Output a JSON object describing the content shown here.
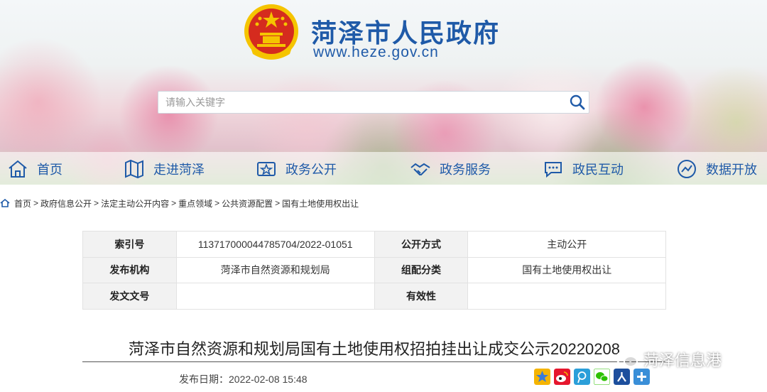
{
  "header": {
    "site_title": "菏泽市人民政府",
    "site_url": "www.heze.gov.cn",
    "search_placeholder": "请输入关键字",
    "emblem_icon": "national-emblem-icon"
  },
  "nav": [
    {
      "label": "首页",
      "icon": "home-icon"
    },
    {
      "label": "走进菏泽",
      "icon": "map-icon"
    },
    {
      "label": "政务公开",
      "icon": "gov-open-icon"
    },
    {
      "label": "政务服务",
      "icon": "handshake-icon"
    },
    {
      "label": "政民互动",
      "icon": "chat-icon"
    },
    {
      "label": "数据开放",
      "icon": "data-icon"
    }
  ],
  "breadcrumb": [
    "首页",
    "政府信息公开",
    "法定主动公开内容",
    "重点领域",
    "公共资源配置",
    "国有土地使用权出让"
  ],
  "meta": {
    "index_label": "索引号",
    "index_value": "113717000044785704/2022-01051",
    "open_label": "公开方式",
    "open_value": "主动公开",
    "org_label": "发布机构",
    "org_value": "菏泽市自然资源和规划局",
    "category_label": "组配分类",
    "category_value": "国有土地使用权出让",
    "doc_label": "发文文号",
    "doc_value": "",
    "valid_label": "有效性",
    "valid_value": ""
  },
  "article": {
    "title": "菏泽市自然资源和规划局国有土地使用权招拍挂出让成交公示20220208",
    "date": "发布日期：2022-02-08 15:48"
  },
  "share": [
    "qzone-icon",
    "weibo-icon",
    "tencent-weibo-icon",
    "wechat-icon",
    "renren-icon",
    "more-share-icon"
  ],
  "watermark": "菏泽信息港",
  "colors": {
    "brand_blue": "#1f5aa8",
    "emblem_red": "#d52b1e",
    "emblem_gold": "#f5c400"
  }
}
